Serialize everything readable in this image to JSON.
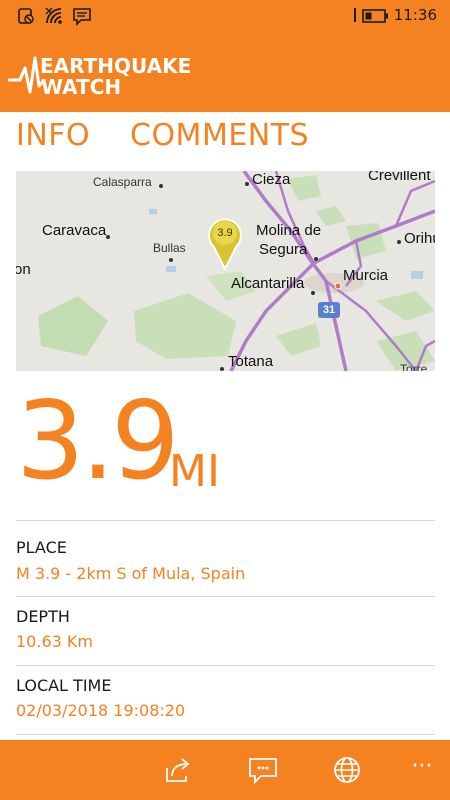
{
  "status_bar": {
    "time": "11:36",
    "icons": [
      "notification-silent-icon",
      "wifi-icon",
      "message-icon",
      "sim-icon",
      "battery-icon"
    ]
  },
  "header": {
    "logo_line1": "EARTHQUAKE",
    "logo_line2": "WATCH",
    "accent_color": "#f58220"
  },
  "tabs": [
    {
      "label": "INFO",
      "selected": true
    },
    {
      "label": "COMMENTS",
      "selected": false
    }
  ],
  "map": {
    "labels": [
      "Calasparra",
      "Cieza",
      "Crevillent",
      "Caravaca",
      "Bullas",
      "Molina de",
      "Segura",
      "Orihu",
      "Murcia",
      "Alcantarilla",
      "Totana",
      "on",
      "Torre"
    ],
    "pin_value": "3.9",
    "road_number": "31"
  },
  "magnitude": {
    "value": "3.9",
    "unit": "MI"
  },
  "details": {
    "place_label": "PLACE",
    "place_value": "M 3.9 - 2km S of Mula, Spain",
    "depth_label": "DEPTH",
    "depth_value": "10.63 Km",
    "local_time_label": "LOCAL TIME",
    "local_time_value": "02/03/2018 19:08:20"
  },
  "app_bar": {
    "buttons": [
      "share-icon",
      "comment-icon",
      "globe-icon",
      "more-icon"
    ],
    "more_glyph": "···"
  }
}
